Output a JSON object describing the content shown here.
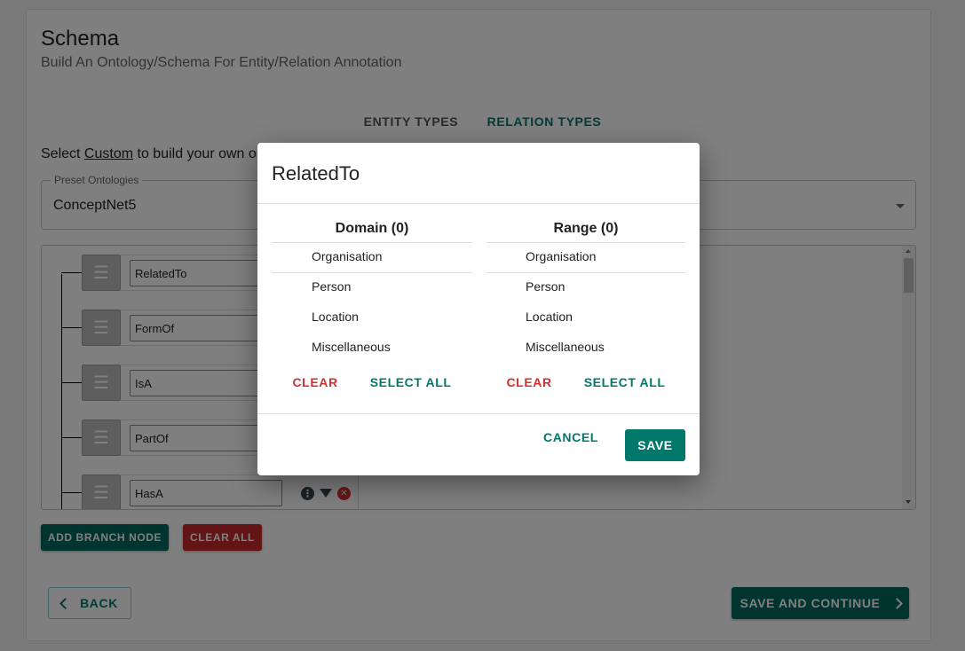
{
  "page": {
    "title": "Schema",
    "subtitle": "Build An Ontology/Schema For Entity/Relation Annotation"
  },
  "tabs": [
    {
      "label": "ENTITY TYPES",
      "active": false
    },
    {
      "label": "RELATION TYPES",
      "active": true
    }
  ],
  "hint": {
    "prefix": "Select ",
    "link": "Custom",
    "suffix": " to build your own ontology"
  },
  "preset": {
    "legend": "Preset Ontologies",
    "value": "ConceptNet5"
  },
  "tree": {
    "nodes": [
      "RelatedTo",
      "FormOf",
      "IsA",
      "PartOf",
      "HasA"
    ],
    "icons": {
      "info": "info-icon",
      "filter": "filter-icon",
      "delete": "delete-icon"
    }
  },
  "buttons": {
    "add_branch": "ADD BRANCH NODE",
    "clear_all": "CLEAR ALL",
    "back": "BACK",
    "save_continue": "SAVE AND CONTINUE"
  },
  "modal": {
    "title": "RelatedTo",
    "domain": {
      "heading": "Domain (0)",
      "items": [
        "Organisation",
        "Person",
        "Location",
        "Miscellaneous"
      ],
      "clear": "CLEAR",
      "select_all": "SELECT ALL"
    },
    "range": {
      "heading": "Range (0)",
      "items": [
        "Organisation",
        "Person",
        "Location",
        "Miscellaneous"
      ],
      "clear": "CLEAR",
      "select_all": "SELECT ALL"
    },
    "cancel": "CANCEL",
    "save": "SAVE"
  },
  "colors": {
    "primary": "#00796b",
    "danger": "#c62828"
  }
}
